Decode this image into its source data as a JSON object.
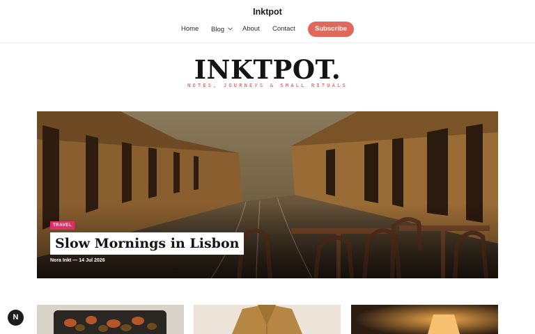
{
  "header": {
    "site_name": "Inktpot",
    "nav": {
      "home": "Home",
      "blog": "Blog",
      "about": "About",
      "contact": "Contact"
    },
    "subscribe_label": "Subscribe"
  },
  "masthead": {
    "title": "INKTPOT.",
    "tagline": "NOTES, JOURNEYS & SMALL RITUALS"
  },
  "featured": {
    "category": "TRAVEL",
    "title": "Slow Mornings in Lisbon",
    "author": "Nora Inkt",
    "date": "14 Jul 2026",
    "meta": "Nora Inkt — 14 Jul 2026"
  },
  "floating": {
    "label": "N"
  },
  "colors": {
    "accent": "#e0685c",
    "badge": "#e0306a",
    "tagline": "#d04b49"
  }
}
